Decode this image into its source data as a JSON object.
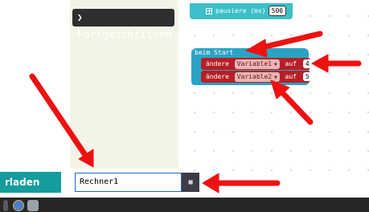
{
  "toolbox": {
    "advanced_label": "Fortgeschritten"
  },
  "blocks": {
    "pause": {
      "label": "pausiere (ms)",
      "value": "500"
    },
    "on_start": {
      "label": "beim Start",
      "statements": [
        {
          "verb": "ändere",
          "variable": "Variable1",
          "mid": "auf",
          "value": "4"
        },
        {
          "verb": "ändere",
          "variable": "Variable2",
          "mid": "auf",
          "value": "5"
        }
      ]
    }
  },
  "footer": {
    "download_label": "rladen",
    "project_name": "Rechner1"
  },
  "colors": {
    "arrow": "#ee1111",
    "set_block": "#b61f25",
    "on_start": "#2aa3c5",
    "basic_block": "#3cbfc8",
    "download_button": "#159c9c"
  },
  "icons": {
    "advanced_chevron": "chevron-down-icon",
    "pause_grid": "grid-icon",
    "save": "save-icon",
    "dropdown": "caret-down-icon"
  }
}
